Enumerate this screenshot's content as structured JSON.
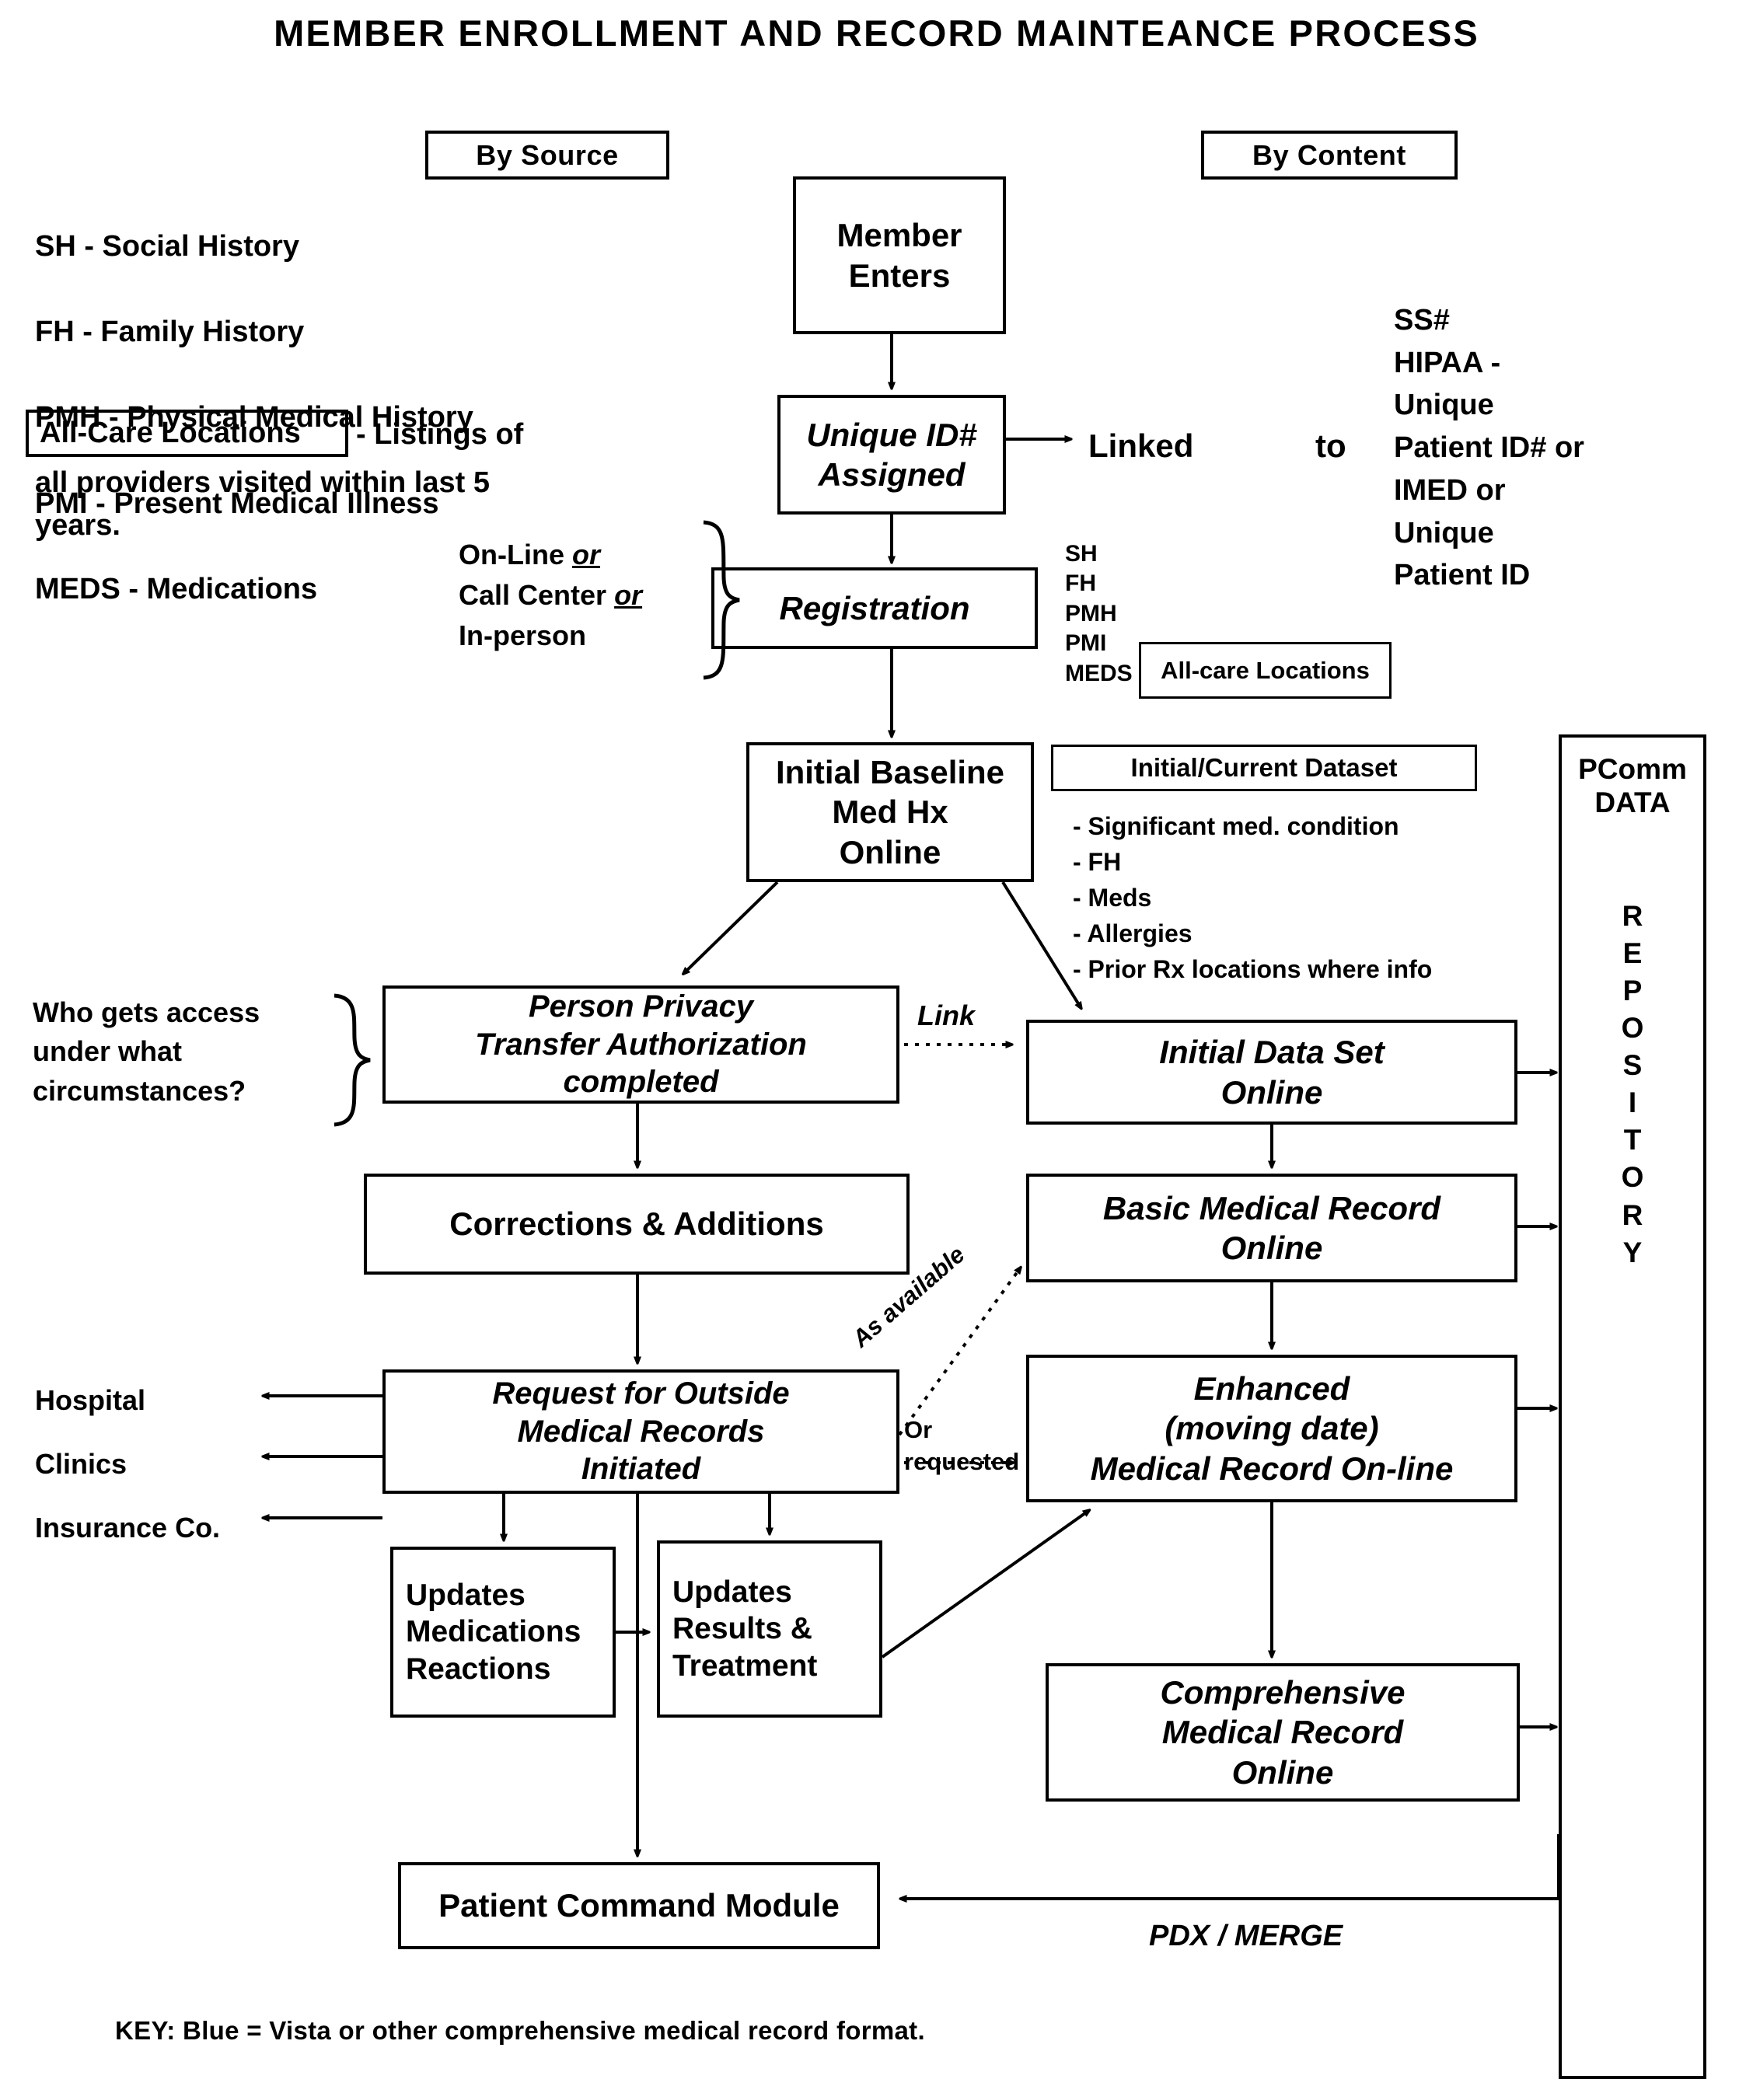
{
  "title": "MEMBER ENROLLMENT AND RECORD MAINTEANCE PROCESS",
  "headers": {
    "by_source": "By Source",
    "by_content": "By Content"
  },
  "legend_abbreviations": {
    "lines": [
      "SH - Social History",
      "FH - Family History",
      "PMH - Physical Medical History",
      "PMI - Present Medical Illness",
      "MEDS - Medications"
    ],
    "all_care_boxed": "All-Care Locations",
    "all_care_tail": "- Listings of",
    "all_care_rest": "all providers visited within last 5\nyears."
  },
  "content_identifiers": "SS#\nHIPAA -\nUnique\nPatient ID# or\nIMED or\nUnique\nPatient ID",
  "nodes": {
    "member_enters": "Member\nEnters",
    "unique_id": "Unique ID#\nAssigned",
    "registration": "Registration",
    "initial_baseline": "Initial Baseline\nMed Hx\nOnline",
    "person_privacy": "Person Privacy\nTransfer Authorization\ncompleted",
    "corrections": "Corrections & Additions",
    "request_outside": "Request for Outside\nMedical Records\nInitiated",
    "updates_meds": "Updates\nMedications\nReactions",
    "updates_results": "Updates\nResults &\nTreatment",
    "patient_command": "Patient Command Module",
    "initial_data_set": "Initial Data Set\nOnline",
    "basic_medical_record": "Basic Medical Record\nOnline",
    "enhanced_record": "Enhanced\n(moving date)\nMedical Record On-line",
    "comprehensive_record": "Comprehensive\nMedical Record\nOnline",
    "all_care_locations": "All-care Locations",
    "initial_current_dataset": "Initial/Current Dataset"
  },
  "annotations": {
    "channels": "On-Line or\nCall Center or\nIn-person",
    "channels_plain_1": "On-Line ",
    "channels_or_1": "or",
    "channels_plain_2": "Call Center ",
    "channels_or_2": "or",
    "channels_plain_3": "In-person",
    "registration_inputs": "SH\nFH\nPMH\nPMI\nMEDS",
    "dataset_items": "- Significant med. condition\n- FH\n- Meds\n- Allergies\n- Prior Rx locations where info",
    "linked": "Linked",
    "to": "to",
    "who_gets_access": "Who gets access\nunder what\ncircumstances?",
    "link": "Link",
    "as_available": "As available",
    "or_requested": "Or\nrequested",
    "external_recipients": [
      "Hospital",
      "Clinics",
      "Insurance Co."
    ],
    "pdx_merge": "PDX / MERGE"
  },
  "repository": {
    "title": "PComm\nDATA",
    "letters": [
      "R",
      "E",
      "P",
      "O",
      "S",
      "I",
      "T",
      "O",
      "R",
      "Y"
    ]
  },
  "key": {
    "text": "KEY:  Blue = Vista or other comprehensive medical record format."
  },
  "colors": {
    "ink": "#000000",
    "paper": "#ffffff"
  }
}
